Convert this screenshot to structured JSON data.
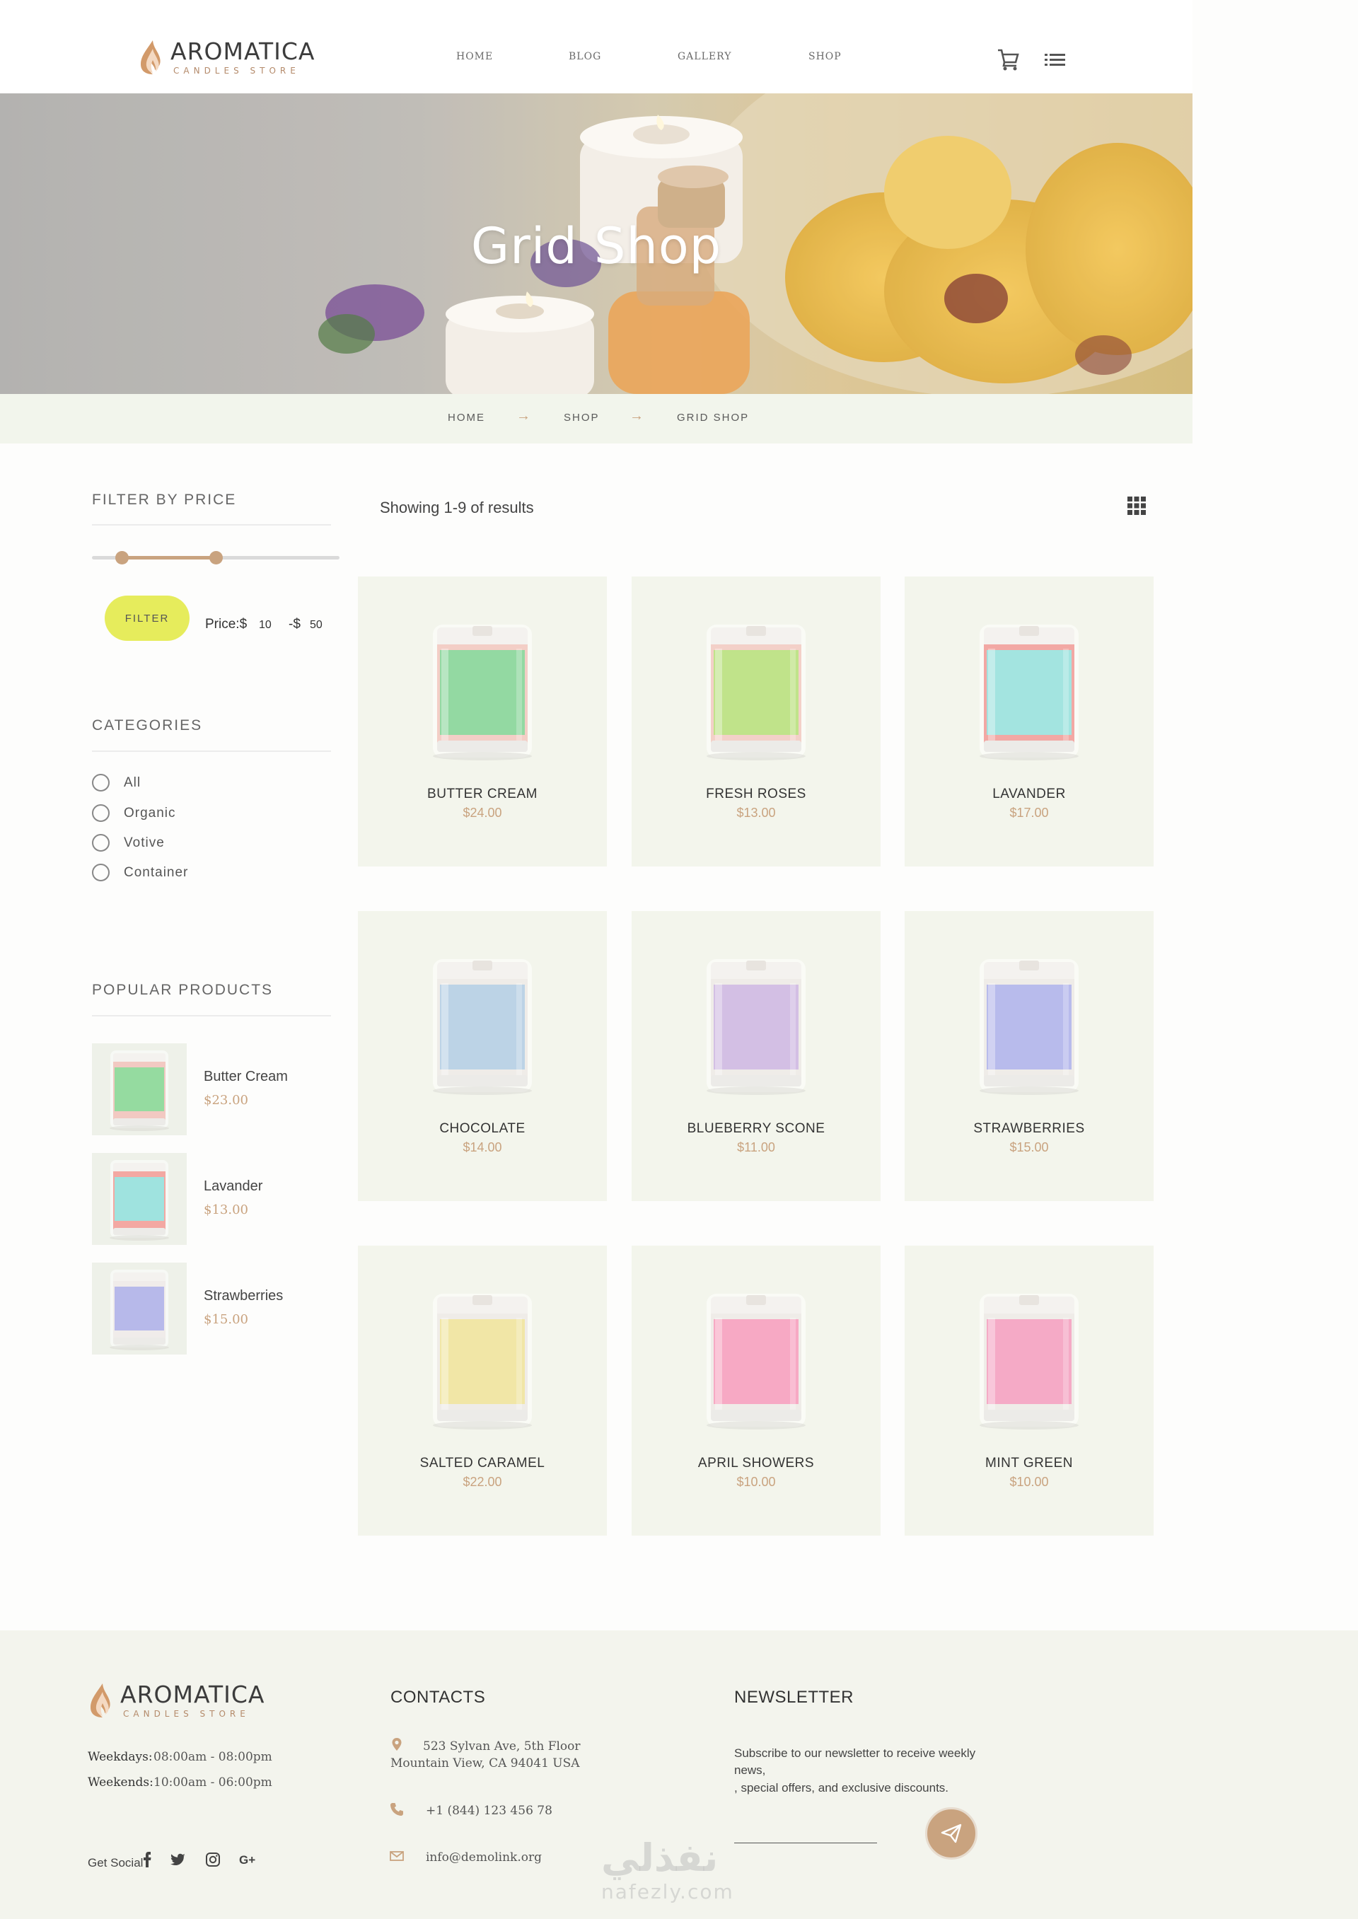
{
  "brand": {
    "name": "AROMATICA",
    "tagline": "CANDLES STORE",
    "accent": "#c9a37f",
    "filter_color": "#e6ec5c"
  },
  "nav": {
    "items": [
      {
        "label": "HOME"
      },
      {
        "label": "BLOG"
      },
      {
        "label": "GALLERY"
      },
      {
        "label": "SHOP"
      }
    ]
  },
  "header_icons": [
    "cart-icon",
    "menu-list-icon"
  ],
  "hero": {
    "title": "Grid Shop"
  },
  "breadcrumb": {
    "items": [
      "HOME",
      "SHOP",
      "GRID SHOP"
    ]
  },
  "sidebar": {
    "filter_title": "FILTER BY PRICE",
    "filter_button": "FILTER",
    "price_prefix": "Price:$",
    "price_min": "10",
    "price_sep": "-$",
    "price_max": "50",
    "categories_title": "CATEGORIES",
    "categories": [
      {
        "label": "All"
      },
      {
        "label": "Organic"
      },
      {
        "label": "Votive"
      },
      {
        "label": "Container"
      }
    ],
    "popular_title": "POPULAR PRODUCTS",
    "popular": [
      {
        "name": "Butter Cream",
        "price": "$23.00",
        "label_color": "#95dba0",
        "top_color": "#f2c9c2"
      },
      {
        "name": "Lavander",
        "price": "$13.00",
        "label_color": "#9fe3df",
        "top_color": "#f3a8a2"
      },
      {
        "name": "Strawberries",
        "price": "$15.00",
        "label_color": "#b7b9ea",
        "top_color": "#f0ecea"
      }
    ]
  },
  "main": {
    "showing": "Showing 1-9 of results",
    "products": [
      {
        "name": "BUTTER CREAM",
        "price": "$24.00",
        "label_color": "#93d9a2",
        "band_color": "#f3cec6"
      },
      {
        "name": "FRESH ROSES",
        "price": "$13.00",
        "label_color": "#c0e38a",
        "band_color": "#f3d0c8"
      },
      {
        "name": "LAVANDER",
        "price": "$17.00",
        "label_color": "#a3e4e0",
        "band_color": "#f2a8a4"
      },
      {
        "name": "CHOCOLATE",
        "price": "$14.00",
        "label_color": "#bcd3e6",
        "band_color": "#efece8"
      },
      {
        "name": "BLUEBERRY SCONE",
        "price": "$11.00",
        "label_color": "#d3bfe4",
        "band_color": "#efece8"
      },
      {
        "name": "STRAWBERRIES",
        "price": "$15.00",
        "label_color": "#b8bbec",
        "band_color": "#efece8"
      },
      {
        "name": "SALTED CARAMEL",
        "price": "$22.00",
        "label_color": "#f1e6a6",
        "band_color": "#efece8"
      },
      {
        "name": "APRIL SHOWERS",
        "price": "$10.00",
        "label_color": "#f7a9c4",
        "band_color": "#efece8"
      },
      {
        "name": "MINT GREEN",
        "price": "$10.00",
        "label_color": "#f5aac6",
        "band_color": "#efece8"
      }
    ]
  },
  "footer": {
    "weekdays_label": "Weekdays:",
    "weekdays_hours": "08:00am - 08:00pm",
    "weekends_label": "Weekends:",
    "weekends_hours": "10:00am - 06:00pm",
    "get_social": "Get Social",
    "social_icons": [
      "facebook-icon",
      "twitter-icon",
      "instagram-icon",
      "google-plus-icon"
    ],
    "contacts_title": "CONTACTS",
    "address_line1": "523 Sylvan Ave, 5th Floor",
    "address_line2": "Mountain View, CA 94041 USA",
    "phone": "+1 (844) 123 456 78",
    "email": "info@demolink.org",
    "newsletter_title": "NEWSLETTER",
    "newsletter_line1": "Subscribe to our newsletter to receive weekly",
    "newsletter_line2": "news,",
    "newsletter_line3": ", special offers, and exclusive discounts."
  },
  "watermark": {
    "arabic": "نفذلي",
    "latin": "nafezly.com"
  }
}
